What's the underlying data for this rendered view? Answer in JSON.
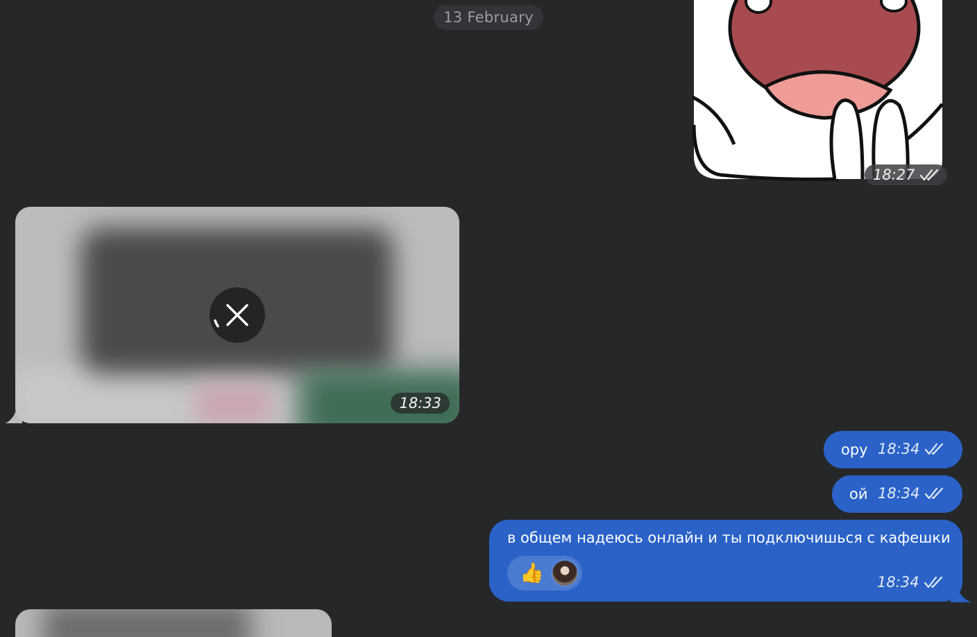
{
  "chat": {
    "date_separator": "13 February",
    "messages": [
      {
        "kind": "sticker",
        "direction": "outgoing",
        "time": "18:27",
        "status": "read-double-check"
      },
      {
        "kind": "media-loading",
        "direction": "incoming",
        "time": "18:33"
      },
      {
        "kind": "text",
        "direction": "outgoing",
        "text": "ору",
        "time": "18:34",
        "status": "read-double-check"
      },
      {
        "kind": "text",
        "direction": "outgoing",
        "text": "ой",
        "time": "18:34",
        "status": "read-double-check"
      },
      {
        "kind": "text",
        "direction": "outgoing",
        "text": "в общем надеюсь онлайн и ты подключишься с кафешки",
        "time": "18:34",
        "status": "read-double-check",
        "reaction": {
          "emoji": "👍",
          "icon": "thumbs-up-emoji"
        }
      }
    ]
  },
  "colors": {
    "background": "#252729",
    "outgoing_bubble": "#2b62c8",
    "date_pill": "#323437"
  }
}
